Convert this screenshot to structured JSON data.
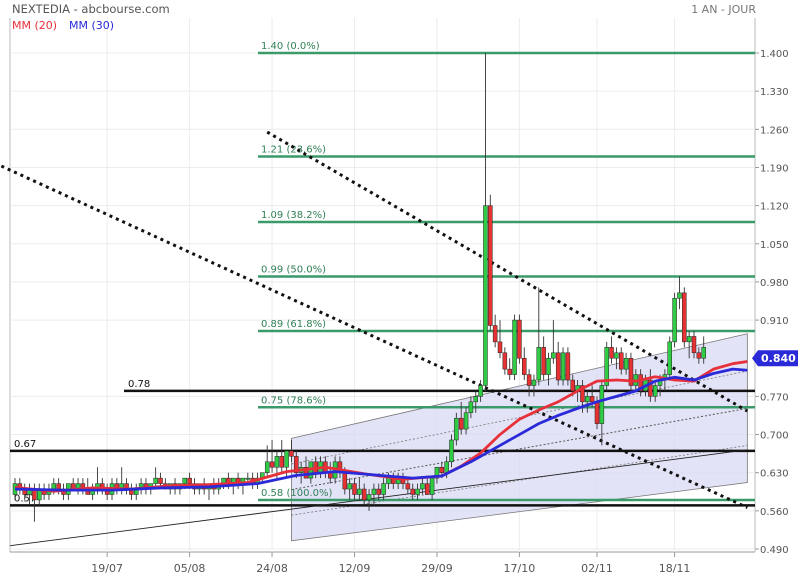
{
  "header": {
    "title": "NEXTEDIA - abcbourse.com",
    "period": "1 AN - JOUR",
    "legend": [
      {
        "label": "MM (20)",
        "color": "#e8303a"
      },
      {
        "label": "MM (30)",
        "color": "#2a2ad8"
      }
    ]
  },
  "chart_data": {
    "type": "candlestick",
    "ylim": [
      0.47,
      1.45
    ],
    "y_ticks": [
      {
        "value": 1.4,
        "label": "1.400"
      },
      {
        "value": 1.33,
        "label": "1.330"
      },
      {
        "value": 1.26,
        "label": "1.260"
      },
      {
        "value": 1.19,
        "label": "1.190"
      },
      {
        "value": 1.12,
        "label": "1.120"
      },
      {
        "value": 1.05,
        "label": "1.050"
      },
      {
        "value": 0.98,
        "label": "0.980"
      },
      {
        "value": 0.91,
        "label": "0.910"
      },
      {
        "value": 0.77,
        "label": "0.770"
      },
      {
        "value": 0.7,
        "label": "0.700"
      },
      {
        "value": 0.63,
        "label": "0.630"
      },
      {
        "value": 0.56,
        "label": "0.560"
      },
      {
        "value": 0.49,
        "label": "0.490"
      }
    ],
    "x_ticks": [
      "19/07",
      "05/08",
      "24/08",
      "12/09",
      "29/09",
      "17/10",
      "02/11",
      "18/11"
    ],
    "x_tick_index": [
      19,
      36,
      53,
      70,
      87,
      104,
      120,
      136
    ],
    "last_price": {
      "value": 0.84,
      "label": "0.840",
      "color": "#2a2ad8"
    },
    "fibonacci": [
      {
        "value": 1.4,
        "label": "1.40  (0.0%)"
      },
      {
        "value": 1.21,
        "label": "1.21  (23.6%)"
      },
      {
        "value": 1.09,
        "label": "1.09  (38.2%)"
      },
      {
        "value": 0.99,
        "label": "0.99  (50.0%)"
      },
      {
        "value": 0.89,
        "label": "0.89  (61.8%)"
      },
      {
        "value": 0.75,
        "label": "0.75  (78.6%)"
      },
      {
        "value": 0.58,
        "label": "0.58  (100.0%)"
      }
    ],
    "levels": [
      {
        "value": 0.78,
        "label": "0.78"
      },
      {
        "value": 0.67,
        "label": "0.67"
      },
      {
        "value": 0.57,
        "label": "0.57"
      }
    ],
    "series": [
      {
        "name": "MM (20)",
        "color": "#e8303a"
      },
      {
        "name": "MM (30)",
        "color": "#2a2ad8"
      }
    ],
    "candles": [
      [
        0.59,
        0.62,
        0.58,
        0.61
      ],
      [
        0.61,
        0.62,
        0.59,
        0.6
      ],
      [
        0.6,
        0.61,
        0.58,
        0.59
      ],
      [
        0.59,
        0.61,
        0.57,
        0.6
      ],
      [
        0.6,
        0.61,
        0.54,
        0.58
      ],
      [
        0.58,
        0.61,
        0.57,
        0.6
      ],
      [
        0.6,
        0.61,
        0.58,
        0.59
      ],
      [
        0.59,
        0.61,
        0.58,
        0.6
      ],
      [
        0.6,
        0.62,
        0.59,
        0.61
      ],
      [
        0.61,
        0.62,
        0.59,
        0.6
      ],
      [
        0.6,
        0.61,
        0.58,
        0.59
      ],
      [
        0.59,
        0.61,
        0.58,
        0.61
      ],
      [
        0.61,
        0.62,
        0.6,
        0.6
      ],
      [
        0.6,
        0.62,
        0.59,
        0.61
      ],
      [
        0.61,
        0.62,
        0.59,
        0.6
      ],
      [
        0.6,
        0.62,
        0.59,
        0.59
      ],
      [
        0.59,
        0.61,
        0.58,
        0.6
      ],
      [
        0.6,
        0.64,
        0.59,
        0.61
      ],
      [
        0.61,
        0.62,
        0.59,
        0.6
      ],
      [
        0.6,
        0.61,
        0.58,
        0.59
      ],
      [
        0.59,
        0.62,
        0.58,
        0.61
      ],
      [
        0.61,
        0.62,
        0.59,
        0.6
      ],
      [
        0.6,
        0.64,
        0.59,
        0.61
      ],
      [
        0.61,
        0.62,
        0.59,
        0.6
      ],
      [
        0.6,
        0.61,
        0.58,
        0.59
      ],
      [
        0.59,
        0.61,
        0.58,
        0.6
      ],
      [
        0.6,
        0.62,
        0.59,
        0.61
      ],
      [
        0.61,
        0.62,
        0.59,
        0.6
      ],
      [
        0.6,
        0.61,
        0.59,
        0.61
      ],
      [
        0.61,
        0.64,
        0.6,
        0.62
      ],
      [
        0.62,
        0.63,
        0.6,
        0.61
      ],
      [
        0.61,
        0.62,
        0.6,
        0.6
      ],
      [
        0.6,
        0.61,
        0.59,
        0.61
      ],
      [
        0.61,
        0.62,
        0.59,
        0.6
      ],
      [
        0.6,
        0.61,
        0.59,
        0.61
      ],
      [
        0.61,
        0.62,
        0.6,
        0.62
      ],
      [
        0.62,
        0.63,
        0.6,
        0.61
      ],
      [
        0.61,
        0.62,
        0.59,
        0.6
      ],
      [
        0.6,
        0.61,
        0.59,
        0.61
      ],
      [
        0.61,
        0.62,
        0.59,
        0.6
      ],
      [
        0.6,
        0.61,
        0.58,
        0.61
      ],
      [
        0.61,
        0.62,
        0.59,
        0.6
      ],
      [
        0.6,
        0.62,
        0.59,
        0.61
      ],
      [
        0.61,
        0.62,
        0.6,
        0.62
      ],
      [
        0.62,
        0.63,
        0.6,
        0.61
      ],
      [
        0.61,
        0.62,
        0.59,
        0.62
      ],
      [
        0.62,
        0.63,
        0.6,
        0.61
      ],
      [
        0.61,
        0.62,
        0.59,
        0.62
      ],
      [
        0.62,
        0.63,
        0.61,
        0.62
      ],
      [
        0.62,
        0.63,
        0.6,
        0.61
      ],
      [
        0.61,
        0.63,
        0.6,
        0.62
      ],
      [
        0.62,
        0.63,
        0.61,
        0.63
      ],
      [
        0.63,
        0.68,
        0.62,
        0.65
      ],
      [
        0.65,
        0.69,
        0.63,
        0.64
      ],
      [
        0.64,
        0.67,
        0.62,
        0.66
      ],
      [
        0.66,
        0.69,
        0.63,
        0.64
      ],
      [
        0.64,
        0.66,
        0.62,
        0.67
      ],
      [
        0.67,
        0.69,
        0.65,
        0.66
      ],
      [
        0.66,
        0.67,
        0.62,
        0.63
      ],
      [
        0.63,
        0.65,
        0.61,
        0.64
      ],
      [
        0.64,
        0.66,
        0.62,
        0.62
      ],
      [
        0.62,
        0.65,
        0.61,
        0.65
      ],
      [
        0.65,
        0.66,
        0.62,
        0.63
      ],
      [
        0.63,
        0.66,
        0.62,
        0.65
      ],
      [
        0.65,
        0.66,
        0.62,
        0.63
      ],
      [
        0.63,
        0.65,
        0.61,
        0.62
      ],
      [
        0.62,
        0.66,
        0.61,
        0.65
      ],
      [
        0.65,
        0.66,
        0.62,
        0.63
      ],
      [
        0.63,
        0.64,
        0.59,
        0.6
      ],
      [
        0.6,
        0.62,
        0.58,
        0.61
      ],
      [
        0.61,
        0.62,
        0.58,
        0.59
      ],
      [
        0.59,
        0.62,
        0.58,
        0.6
      ],
      [
        0.6,
        0.61,
        0.57,
        0.58
      ],
      [
        0.58,
        0.6,
        0.56,
        0.59
      ],
      [
        0.59,
        0.61,
        0.57,
        0.6
      ],
      [
        0.6,
        0.61,
        0.58,
        0.59
      ],
      [
        0.59,
        0.62,
        0.58,
        0.61
      ],
      [
        0.61,
        0.63,
        0.6,
        0.62
      ],
      [
        0.62,
        0.63,
        0.6,
        0.61
      ],
      [
        0.61,
        0.63,
        0.6,
        0.62
      ],
      [
        0.62,
        0.63,
        0.6,
        0.61
      ],
      [
        0.61,
        0.62,
        0.59,
        0.6
      ],
      [
        0.6,
        0.61,
        0.58,
        0.59
      ],
      [
        0.59,
        0.61,
        0.58,
        0.6
      ],
      [
        0.6,
        0.62,
        0.59,
        0.61
      ],
      [
        0.61,
        0.62,
        0.59,
        0.59
      ],
      [
        0.59,
        0.62,
        0.58,
        0.62
      ],
      [
        0.62,
        0.64,
        0.61,
        0.64
      ],
      [
        0.64,
        0.65,
        0.62,
        0.63
      ],
      [
        0.63,
        0.66,
        0.62,
        0.65
      ],
      [
        0.65,
        0.7,
        0.64,
        0.69
      ],
      [
        0.69,
        0.74,
        0.68,
        0.73
      ],
      [
        0.73,
        0.76,
        0.7,
        0.71
      ],
      [
        0.71,
        0.75,
        0.7,
        0.74
      ],
      [
        0.74,
        0.77,
        0.73,
        0.76
      ],
      [
        0.76,
        0.78,
        0.74,
        0.77
      ],
      [
        0.77,
        0.8,
        0.76,
        0.79
      ],
      [
        0.79,
        1.4,
        0.78,
        1.12
      ],
      [
        1.12,
        1.14,
        0.89,
        0.9
      ],
      [
        0.9,
        0.92,
        0.86,
        0.87
      ],
      [
        0.87,
        0.91,
        0.84,
        0.85
      ],
      [
        0.85,
        0.86,
        0.81,
        0.82
      ],
      [
        0.82,
        0.84,
        0.8,
        0.81
      ],
      [
        0.81,
        0.92,
        0.8,
        0.91
      ],
      [
        0.91,
        0.92,
        0.83,
        0.84
      ],
      [
        0.84,
        0.86,
        0.8,
        0.81
      ],
      [
        0.81,
        0.82,
        0.77,
        0.79
      ],
      [
        0.79,
        0.81,
        0.77,
        0.8
      ],
      [
        0.8,
        0.97,
        0.79,
        0.86
      ],
      [
        0.86,
        0.88,
        0.8,
        0.81
      ],
      [
        0.81,
        0.85,
        0.79,
        0.84
      ],
      [
        0.84,
        0.91,
        0.83,
        0.85
      ],
      [
        0.85,
        0.87,
        0.79,
        0.8
      ],
      [
        0.8,
        0.86,
        0.79,
        0.85
      ],
      [
        0.85,
        0.86,
        0.79,
        0.8
      ],
      [
        0.8,
        0.81,
        0.77,
        0.78
      ],
      [
        0.78,
        0.8,
        0.76,
        0.79
      ],
      [
        0.79,
        0.8,
        0.74,
        0.76
      ],
      [
        0.76,
        0.78,
        0.74,
        0.77
      ],
      [
        0.77,
        0.79,
        0.75,
        0.76
      ],
      [
        0.76,
        0.77,
        0.71,
        0.72
      ],
      [
        0.72,
        0.8,
        0.68,
        0.79
      ],
      [
        0.79,
        0.87,
        0.78,
        0.86
      ],
      [
        0.86,
        0.88,
        0.83,
        0.84
      ],
      [
        0.84,
        0.86,
        0.82,
        0.85
      ],
      [
        0.85,
        0.86,
        0.81,
        0.82
      ],
      [
        0.82,
        0.85,
        0.81,
        0.84
      ],
      [
        0.84,
        0.85,
        0.78,
        0.79
      ],
      [
        0.79,
        0.82,
        0.78,
        0.81
      ],
      [
        0.81,
        0.82,
        0.77,
        0.78
      ],
      [
        0.78,
        0.81,
        0.77,
        0.8
      ],
      [
        0.8,
        0.82,
        0.76,
        0.77
      ],
      [
        0.77,
        0.8,
        0.76,
        0.79
      ],
      [
        0.79,
        0.81,
        0.77,
        0.8
      ],
      [
        0.8,
        0.82,
        0.78,
        0.81
      ],
      [
        0.81,
        0.88,
        0.8,
        0.87
      ],
      [
        0.87,
        0.96,
        0.86,
        0.95
      ],
      [
        0.95,
        0.99,
        0.93,
        0.96
      ],
      [
        0.96,
        0.97,
        0.86,
        0.87
      ],
      [
        0.87,
        0.89,
        0.84,
        0.88
      ],
      [
        0.88,
        0.89,
        0.84,
        0.85
      ],
      [
        0.85,
        0.86,
        0.83,
        0.84
      ],
      [
        0.84,
        0.88,
        0.83,
        0.86
      ]
    ],
    "mm20": [
      [
        0,
        0.603
      ],
      [
        8,
        0.596
      ],
      [
        16,
        0.602
      ],
      [
        24,
        0.6
      ],
      [
        32,
        0.606
      ],
      [
        40,
        0.608
      ],
      [
        48,
        0.612
      ],
      [
        56,
        0.632
      ],
      [
        64,
        0.64
      ],
      [
        72,
        0.628
      ],
      [
        80,
        0.618
      ],
      [
        88,
        0.624
      ],
      [
        92,
        0.642
      ],
      [
        96,
        0.666
      ],
      [
        100,
        0.7
      ],
      [
        104,
        0.728
      ],
      [
        108,
        0.745
      ],
      [
        112,
        0.76
      ],
      [
        116,
        0.78
      ],
      [
        120,
        0.798
      ],
      [
        124,
        0.8
      ],
      [
        128,
        0.798
      ],
      [
        132,
        0.806
      ],
      [
        136,
        0.8
      ],
      [
        140,
        0.798
      ],
      [
        144,
        0.82
      ],
      [
        148,
        0.83
      ],
      [
        151,
        0.834
      ]
    ],
    "mm30": [
      [
        0,
        0.6
      ],
      [
        10,
        0.598
      ],
      [
        20,
        0.598
      ],
      [
        30,
        0.602
      ],
      [
        40,
        0.604
      ],
      [
        50,
        0.61
      ],
      [
        58,
        0.625
      ],
      [
        66,
        0.632
      ],
      [
        74,
        0.626
      ],
      [
        82,
        0.62
      ],
      [
        88,
        0.624
      ],
      [
        94,
        0.65
      ],
      [
        100,
        0.68
      ],
      [
        104,
        0.7
      ],
      [
        108,
        0.72
      ],
      [
        112,
        0.735
      ],
      [
        116,
        0.748
      ],
      [
        120,
        0.76
      ],
      [
        124,
        0.77
      ],
      [
        128,
        0.78
      ],
      [
        132,
        0.798
      ],
      [
        136,
        0.805
      ],
      [
        140,
        0.8
      ],
      [
        144,
        0.812
      ],
      [
        148,
        0.82
      ],
      [
        151,
        0.818
      ]
    ],
    "trendlines": [
      {
        "style": "dotted",
        "from": [
          -12,
          1.23
        ],
        "to": [
          151,
          0.566
        ]
      },
      {
        "style": "dotted",
        "from": [
          52,
          1.255
        ],
        "to": [
          151,
          0.743
        ]
      },
      {
        "style": "solid-thin",
        "from": [
          -1,
          0.496
        ],
        "to": [
          151,
          0.672
        ]
      }
    ],
    "regression_channel": {
      "x": [
        57,
        151
      ],
      "upper": [
        0.693,
        0.885
      ],
      "middle": [
        0.599,
        0.748
      ],
      "lower": [
        0.505,
        0.612
      ],
      "fill": "#d9d9f5"
    }
  }
}
